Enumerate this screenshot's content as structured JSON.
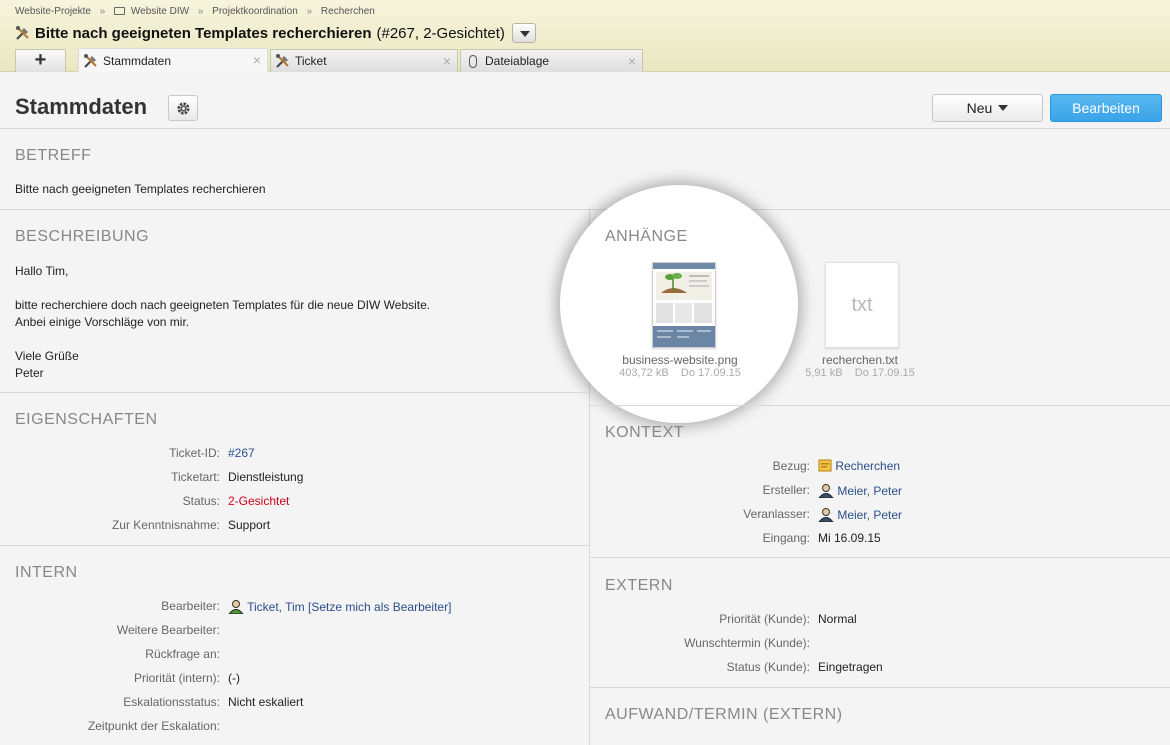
{
  "breadcrumb": [
    "Website-Projekte",
    "Website DIW",
    "Projektkoordination",
    "Recherchen"
  ],
  "title": {
    "main": "Bitte nach geeigneten Templates recherchieren",
    "suffix": "(#267, 2-Gesichtet)"
  },
  "tabs": [
    {
      "label": "Stammdaten",
      "icon": "tools-icon",
      "active": true
    },
    {
      "label": "Ticket",
      "icon": "tools-icon",
      "active": false
    },
    {
      "label": "Dateiablage",
      "icon": "paperclip-icon",
      "active": false
    }
  ],
  "add_tab_label": "+",
  "page_title": "Stammdaten",
  "buttons": {
    "new": "Neu",
    "edit": "Bearbeiten"
  },
  "betreff": {
    "heading": "BETREFF",
    "text": "Bitte nach geeigneten Templates recherchieren"
  },
  "beschreibung": {
    "heading": "BESCHREIBUNG",
    "lines": [
      "Hallo Tim,",
      "bitte recherchiere doch nach geeigneten Templates für die neue DIW Website.",
      "Anbei einige Vorschläge von mir.",
      "Viele Grüße",
      "Peter"
    ]
  },
  "anhaenge": {
    "heading": "ANHÄNGE",
    "files": [
      {
        "name": "business-website.png",
        "size": "403,72 kB",
        "date": "Do 17.09.15"
      },
      {
        "name": "recherchen.txt",
        "size": "5,91 kB",
        "date": "Do 17.09.15",
        "thumb_label": "txt"
      }
    ]
  },
  "eigenschaften": {
    "heading": "EIGENSCHAFTEN",
    "rows": [
      {
        "label": "Ticket-ID:",
        "value": "#267"
      },
      {
        "label": "Ticketart:",
        "value": "Dienstleistung"
      },
      {
        "label": "Status:",
        "value": "2-Gesichtet"
      },
      {
        "label": "Zur Kenntnisnahme:",
        "value": "Support"
      }
    ]
  },
  "kontext": {
    "heading": "KONTEXT",
    "rows": [
      {
        "label": "Bezug:",
        "value": "Recherchen"
      },
      {
        "label": "Ersteller:",
        "value": "Meier, Peter"
      },
      {
        "label": "Veranlasser:",
        "value": "Meier, Peter"
      },
      {
        "label": "Eingang:",
        "value": "Mi 16.09.15"
      }
    ]
  },
  "intern": {
    "heading": "INTERN",
    "rows": [
      {
        "label": "Bearbeiter:",
        "value": "Ticket, Tim",
        "extra": "[Setze mich als Bearbeiter]"
      },
      {
        "label": "Weitere Bearbeiter:",
        "value": ""
      },
      {
        "label": "Rückfrage an:",
        "value": ""
      },
      {
        "label": "Priorität (intern):",
        "value": "(-)"
      },
      {
        "label": "Eskalationsstatus:",
        "value": "Nicht eskaliert"
      },
      {
        "label": "Zeitpunkt der Eskalation:",
        "value": ""
      }
    ]
  },
  "extern": {
    "heading": "EXTERN",
    "rows": [
      {
        "label": "Priorität (Kunde):",
        "value": "Normal"
      },
      {
        "label": "Wunschtermin (Kunde):",
        "value": ""
      },
      {
        "label": "Status (Kunde):",
        "value": "Eingetragen"
      }
    ]
  },
  "aufwand": {
    "heading": "AUFWAND/TERMIN (EXTERN)"
  },
  "colors": {
    "link": "#2a4f8a",
    "status_red": "#d0021b",
    "primary_button": "#3aa3e8",
    "header_bg": "#f3f0d2"
  }
}
